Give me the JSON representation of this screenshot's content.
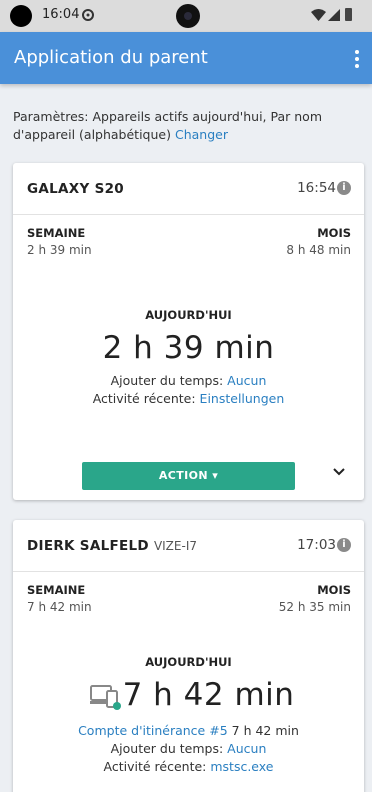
{
  "status_bar": {
    "time": "16:04",
    "icons": [
      "settings-icon",
      "wifi-icon",
      "signal-icon",
      "battery-icon"
    ]
  },
  "app_bar": {
    "title": "Application du parent",
    "menu_icon": "more-vert-icon"
  },
  "settings": {
    "text": "Paramètres: Appareils actifs aujourd'hui,  Par nom d'appareil (alphabétique)",
    "change_link": "Changer"
  },
  "colors": {
    "app_bar": "#4a90d9",
    "action_button": "#2aa68a",
    "link": "#2a7fc1",
    "status_dot": "#2aa68a"
  },
  "devices": [
    {
      "name": "GALAXY S20",
      "sub": "",
      "time": "16:54",
      "week_label": "SEMAINE",
      "week_value": "2 h 39 min",
      "month_label": "MOIS",
      "month_value": "8 h 48 min",
      "today_label": "AUJOURD'HUI",
      "today_value": "2 h 39 min",
      "add_time_label": "Ajouter du temps:",
      "add_time_value": "Aucun",
      "recent_label": "Activité récente:",
      "recent_value": "Einstellungen",
      "action_label": "ACTION",
      "expand_icon": "chevron-down-icon"
    },
    {
      "name": "DIERK SALFELD",
      "sub": "VIZE-I7",
      "time": "17:03",
      "week_label": "SEMAINE",
      "week_value": "7 h 42 min",
      "month_label": "MOIS",
      "month_value": "52 h 35 min",
      "today_label": "AUJOURD'HUI",
      "today_value": "7 h 42 min",
      "device_icon": "computer-phone-icon",
      "account_link": "Compte d'itinérance #5",
      "account_time": "7 h 42 min",
      "add_time_label": "Ajouter du temps:",
      "add_time_value": "Aucun",
      "recent_label": "Activité récente:",
      "recent_value": "mstsc.exe"
    }
  ]
}
